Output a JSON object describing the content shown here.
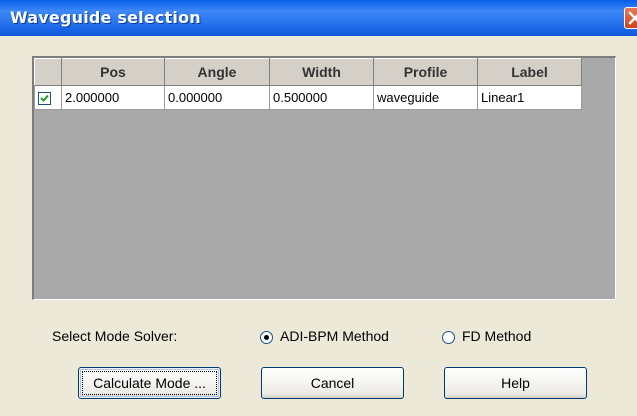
{
  "window": {
    "title": "Waveguide selection"
  },
  "table": {
    "columns": [
      "Pos",
      "Angle",
      "Width",
      "Profile",
      "Label"
    ],
    "rows": [
      {
        "checked": true,
        "cells": [
          "2.000000",
          "0.000000",
          "0.500000",
          "waveguide",
          "Linear1"
        ]
      }
    ]
  },
  "solver": {
    "label": "Select Mode Solver:",
    "options": [
      "ADI-BPM Method",
      "FD Method"
    ],
    "selected": "ADI-BPM Method"
  },
  "buttons": {
    "calculate": "Calculate Mode ...",
    "cancel": "Cancel",
    "help": "Help"
  },
  "colors": {
    "titlebar": "#1c6ff0",
    "dialog": "#ece9d8",
    "grid_background": "#a9a9a9"
  }
}
